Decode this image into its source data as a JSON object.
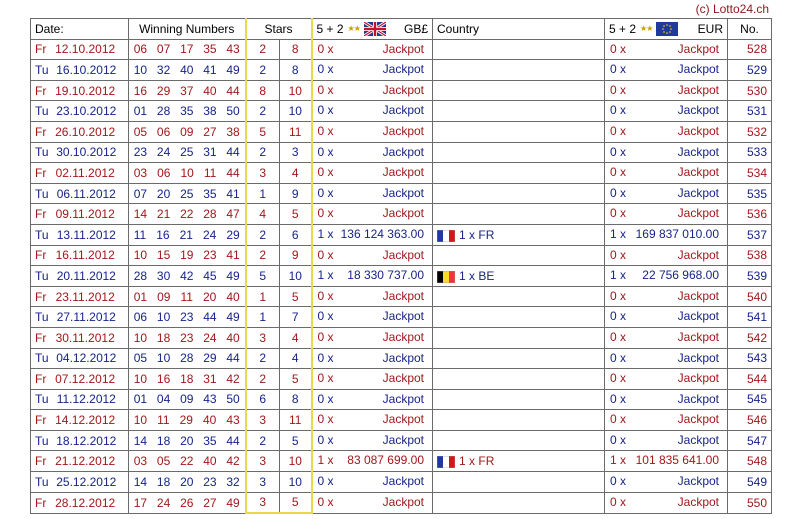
{
  "copyright": "(c) Lotto24.ch",
  "headers": {
    "date": "Date:",
    "numbers": "Winning Numbers",
    "stars": "Stars",
    "gbp_prefix": "5 + 2",
    "gbp_currency": "GB£",
    "country": "Country",
    "eur_prefix": "5 + 2",
    "eur_currency": "EUR",
    "no": "No."
  },
  "rows": [
    {
      "day": "Fr",
      "date": "12.10.2012",
      "n": [
        "06",
        "07",
        "17",
        "35",
        "43"
      ],
      "s": [
        "2",
        "8"
      ],
      "g_cnt": "0 x",
      "g_amt": "Jackpot",
      "country": "",
      "flag": "",
      "e_cnt": "0 x",
      "e_amt": "Jackpot",
      "no": "528"
    },
    {
      "day": "Tu",
      "date": "16.10.2012",
      "n": [
        "10",
        "32",
        "40",
        "41",
        "49"
      ],
      "s": [
        "2",
        "8"
      ],
      "g_cnt": "0 x",
      "g_amt": "Jackpot",
      "country": "",
      "flag": "",
      "e_cnt": "0 x",
      "e_amt": "Jackpot",
      "no": "529"
    },
    {
      "day": "Fr",
      "date": "19.10.2012",
      "n": [
        "16",
        "29",
        "37",
        "40",
        "44"
      ],
      "s": [
        "8",
        "10"
      ],
      "g_cnt": "0 x",
      "g_amt": "Jackpot",
      "country": "",
      "flag": "",
      "e_cnt": "0 x",
      "e_amt": "Jackpot",
      "no": "530"
    },
    {
      "day": "Tu",
      "date": "23.10.2012",
      "n": [
        "01",
        "28",
        "35",
        "38",
        "50"
      ],
      "s": [
        "2",
        "10"
      ],
      "g_cnt": "0 x",
      "g_amt": "Jackpot",
      "country": "",
      "flag": "",
      "e_cnt": "0 x",
      "e_amt": "Jackpot",
      "no": "531"
    },
    {
      "day": "Fr",
      "date": "26.10.2012",
      "n": [
        "05",
        "06",
        "09",
        "27",
        "38"
      ],
      "s": [
        "5",
        "11"
      ],
      "g_cnt": "0 x",
      "g_amt": "Jackpot",
      "country": "",
      "flag": "",
      "e_cnt": "0 x",
      "e_amt": "Jackpot",
      "no": "532"
    },
    {
      "day": "Tu",
      "date": "30.10.2012",
      "n": [
        "23",
        "24",
        "25",
        "31",
        "44"
      ],
      "s": [
        "2",
        "3"
      ],
      "g_cnt": "0 x",
      "g_amt": "Jackpot",
      "country": "",
      "flag": "",
      "e_cnt": "0 x",
      "e_amt": "Jackpot",
      "no": "533"
    },
    {
      "day": "Fr",
      "date": "02.11.2012",
      "n": [
        "03",
        "06",
        "10",
        "11",
        "44"
      ],
      "s": [
        "3",
        "4"
      ],
      "g_cnt": "0 x",
      "g_amt": "Jackpot",
      "country": "",
      "flag": "",
      "e_cnt": "0 x",
      "e_amt": "Jackpot",
      "no": "534"
    },
    {
      "day": "Tu",
      "date": "06.11.2012",
      "n": [
        "07",
        "20",
        "25",
        "35",
        "41"
      ],
      "s": [
        "1",
        "9"
      ],
      "g_cnt": "0 x",
      "g_amt": "Jackpot",
      "country": "",
      "flag": "",
      "e_cnt": "0 x",
      "e_amt": "Jackpot",
      "no": "535"
    },
    {
      "day": "Fr",
      "date": "09.11.2012",
      "n": [
        "14",
        "21",
        "22",
        "28",
        "47"
      ],
      "s": [
        "4",
        "5"
      ],
      "g_cnt": "0 x",
      "g_amt": "Jackpot",
      "country": "",
      "flag": "",
      "e_cnt": "0 x",
      "e_amt": "Jackpot",
      "no": "536"
    },
    {
      "day": "Tu",
      "date": "13.11.2012",
      "n": [
        "11",
        "16",
        "21",
        "24",
        "29"
      ],
      "s": [
        "2",
        "6"
      ],
      "g_cnt": "1 x",
      "g_amt": "136 124 363.00",
      "country": "1 x FR",
      "flag": "fr",
      "e_cnt": "1 x",
      "e_amt": "169 837 010.00",
      "no": "537"
    },
    {
      "day": "Fr",
      "date": "16.11.2012",
      "n": [
        "10",
        "15",
        "19",
        "23",
        "41"
      ],
      "s": [
        "2",
        "9"
      ],
      "g_cnt": "0 x",
      "g_amt": "Jackpot",
      "country": "",
      "flag": "",
      "e_cnt": "0 x",
      "e_amt": "Jackpot",
      "no": "538"
    },
    {
      "day": "Tu",
      "date": "20.11.2012",
      "n": [
        "28",
        "30",
        "42",
        "45",
        "49"
      ],
      "s": [
        "5",
        "10"
      ],
      "g_cnt": "1 x",
      "g_amt": "18 330 737.00",
      "country": "1 x BE",
      "flag": "be",
      "e_cnt": "1 x",
      "e_amt": "22 756 968.00",
      "no": "539"
    },
    {
      "day": "Fr",
      "date": "23.11.2012",
      "n": [
        "01",
        "09",
        "11",
        "20",
        "40"
      ],
      "s": [
        "1",
        "5"
      ],
      "g_cnt": "0 x",
      "g_amt": "Jackpot",
      "country": "",
      "flag": "",
      "e_cnt": "0 x",
      "e_amt": "Jackpot",
      "no": "540"
    },
    {
      "day": "Tu",
      "date": "27.11.2012",
      "n": [
        "06",
        "10",
        "23",
        "44",
        "49"
      ],
      "s": [
        "1",
        "7"
      ],
      "g_cnt": "0 x",
      "g_amt": "Jackpot",
      "country": "",
      "flag": "",
      "e_cnt": "0 x",
      "e_amt": "Jackpot",
      "no": "541"
    },
    {
      "day": "Fr",
      "date": "30.11.2012",
      "n": [
        "10",
        "18",
        "23",
        "24",
        "40"
      ],
      "s": [
        "3",
        "4"
      ],
      "g_cnt": "0 x",
      "g_amt": "Jackpot",
      "country": "",
      "flag": "",
      "e_cnt": "0 x",
      "e_amt": "Jackpot",
      "no": "542"
    },
    {
      "day": "Tu",
      "date": "04.12.2012",
      "n": [
        "05",
        "10",
        "28",
        "29",
        "44"
      ],
      "s": [
        "2",
        "4"
      ],
      "g_cnt": "0 x",
      "g_amt": "Jackpot",
      "country": "",
      "flag": "",
      "e_cnt": "0 x",
      "e_amt": "Jackpot",
      "no": "543"
    },
    {
      "day": "Fr",
      "date": "07.12.2012",
      "n": [
        "10",
        "16",
        "18",
        "31",
        "42"
      ],
      "s": [
        "2",
        "5"
      ],
      "g_cnt": "0 x",
      "g_amt": "Jackpot",
      "country": "",
      "flag": "",
      "e_cnt": "0 x",
      "e_amt": "Jackpot",
      "no": "544"
    },
    {
      "day": "Tu",
      "date": "11.12.2012",
      "n": [
        "01",
        "04",
        "09",
        "43",
        "50"
      ],
      "s": [
        "6",
        "8"
      ],
      "g_cnt": "0 x",
      "g_amt": "Jackpot",
      "country": "",
      "flag": "",
      "e_cnt": "0 x",
      "e_amt": "Jackpot",
      "no": "545"
    },
    {
      "day": "Fr",
      "date": "14.12.2012",
      "n": [
        "10",
        "11",
        "29",
        "40",
        "43"
      ],
      "s": [
        "3",
        "11"
      ],
      "g_cnt": "0 x",
      "g_amt": "Jackpot",
      "country": "",
      "flag": "",
      "e_cnt": "0 x",
      "e_amt": "Jackpot",
      "no": "546"
    },
    {
      "day": "Tu",
      "date": "18.12.2012",
      "n": [
        "14",
        "18",
        "20",
        "35",
        "44"
      ],
      "s": [
        "2",
        "5"
      ],
      "g_cnt": "0 x",
      "g_amt": "Jackpot",
      "country": "",
      "flag": "",
      "e_cnt": "0 x",
      "e_amt": "Jackpot",
      "no": "547"
    },
    {
      "day": "Fr",
      "date": "21.12.2012",
      "n": [
        "03",
        "05",
        "22",
        "40",
        "42"
      ],
      "s": [
        "3",
        "10"
      ],
      "g_cnt": "1 x",
      "g_amt": "83 087 699.00",
      "country": "1 x FR",
      "flag": "fr",
      "e_cnt": "1 x",
      "e_amt": "101 835 641.00",
      "no": "548"
    },
    {
      "day": "Tu",
      "date": "25.12.2012",
      "n": [
        "14",
        "18",
        "20",
        "23",
        "32"
      ],
      "s": [
        "3",
        "10"
      ],
      "g_cnt": "0 x",
      "g_amt": "Jackpot",
      "country": "",
      "flag": "",
      "e_cnt": "0 x",
      "e_amt": "Jackpot",
      "no": "549"
    },
    {
      "day": "Fr",
      "date": "28.12.2012",
      "n": [
        "17",
        "24",
        "26",
        "27",
        "49"
      ],
      "s": [
        "3",
        "5"
      ],
      "g_cnt": "0 x",
      "g_amt": "Jackpot",
      "country": "",
      "flag": "",
      "e_cnt": "0 x",
      "e_amt": "Jackpot",
      "no": "550"
    }
  ],
  "colors": {
    "friday": "#a0181a",
    "tuesday": "#16238a",
    "stars_border": "#e6d94c",
    "grid": "#6b6b6b"
  },
  "icons": {
    "stars_header": "stars-icon",
    "gbp_header": "uk-flag-icon",
    "eur_header": "eu-flag-icon",
    "country_flags": [
      "france-flag-icon",
      "belgium-flag-icon"
    ]
  }
}
